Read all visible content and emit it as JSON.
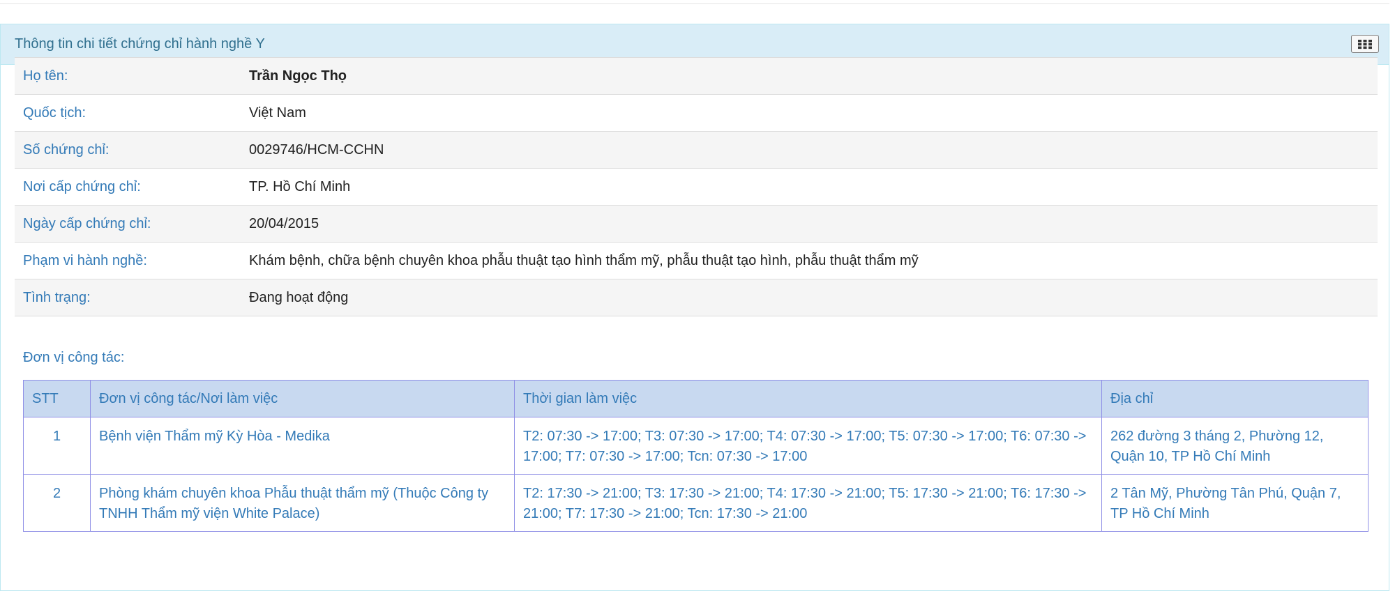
{
  "panel": {
    "title": "Thông tin chi tiết chứng chỉ hành nghề Y",
    "grid_icon": "grid-icon"
  },
  "info": [
    {
      "label": "Họ tên:",
      "value": "Trần Ngọc Thọ"
    },
    {
      "label": "Quốc tịch:",
      "value": "Việt Nam"
    },
    {
      "label": "Số chứng chỉ:",
      "value": "0029746/HCM-CCHN"
    },
    {
      "label": "Nơi cấp chứng chỉ:",
      "value": "TP. Hồ Chí Minh"
    },
    {
      "label": "Ngày cấp chứng chỉ:",
      "value": "20/04/2015"
    },
    {
      "label": "Phạm vi hành nghề:",
      "value": "Khám bệnh, chữa bệnh chuyên khoa phẫu thuật tạo hình thẩm mỹ, phẫu thuật tạo hình, phẫu thuật thẩm mỹ"
    },
    {
      "label": "Tình trạng:",
      "value": "Đang hoạt động"
    }
  ],
  "work_units": {
    "label": "Đơn vị công tác:",
    "headers": [
      "STT",
      "Đơn vị công tác/Nơi làm việc",
      "Thời gian làm việc",
      "Địa chỉ"
    ],
    "rows": [
      {
        "stt": "1",
        "unit": "Bệnh viện Thẩm mỹ Kỳ Hòa - Medika",
        "time": "T2: 07:30 -> 17:00; T3: 07:30 -> 17:00; T4: 07:30 -> 17:00; T5: 07:30 -> 17:00; T6: 07:30 -> 17:00; T7: 07:30 -> 17:00; Tcn: 07:30 -> 17:00",
        "address": "262 đường 3 tháng 2, Phường 12, Quận 10, TP Hồ Chí Minh"
      },
      {
        "stt": "2",
        "unit": "Phòng khám chuyên khoa Phẫu thuật thẩm mỹ (Thuộc Công ty TNHH Thẩm mỹ viện White Palace)",
        "time": "T2: 17:30 -> 21:00; T3: 17:30 -> 21:00; T4: 17:30 -> 21:00; T5: 17:30 -> 21:00; T6: 17:30 -> 21:00; T7: 17:30 -> 21:00; Tcn: 17:30 -> 21:00",
        "address": "2 Tân Mỹ, Phường Tân Phú, Quận 7, TP Hồ Chí Minh"
      }
    ]
  },
  "colors": {
    "heading_bg": "#d9edf7",
    "heading_text": "#31708f",
    "label_text": "#337ab7",
    "table_header_bg": "#c8d9f0",
    "table_border": "#8f8fe6"
  }
}
